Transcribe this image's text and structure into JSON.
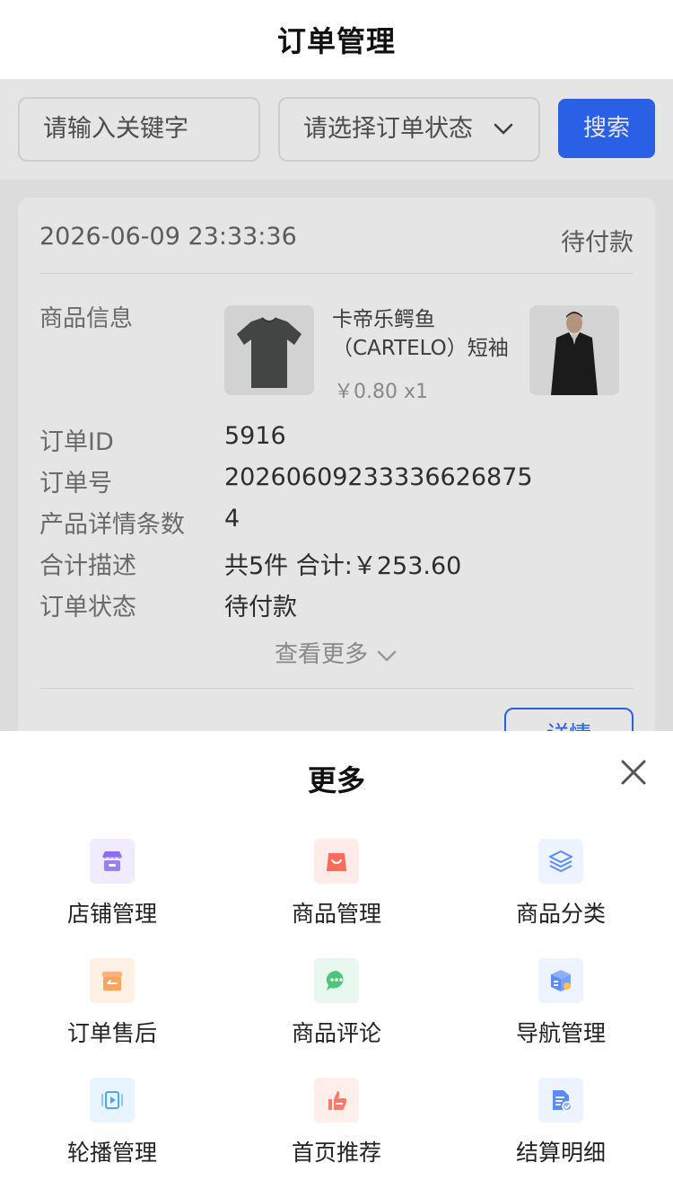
{
  "header": {
    "title": "订单管理"
  },
  "search": {
    "keyword_placeholder": "请输入关键字",
    "status_placeholder": "请选择订单状态",
    "search_label": "搜索"
  },
  "order": {
    "datetime": "2026-06-09 23:33:36",
    "status": "待付款",
    "product_info_label": "商品信息",
    "product_name": "卡帝乐鳄鱼（CARTELO）短袖T恤…",
    "product_price": "￥0.80 x1",
    "fields": [
      {
        "label": "订单ID",
        "value": "5916"
      },
      {
        "label": "订单号",
        "value": "20260609233336626875"
      },
      {
        "label": "产品详情条数",
        "value": "4"
      },
      {
        "label": "合计描述",
        "value": "共5件 合计:￥253.60"
      },
      {
        "label": "订单状态",
        "value": "待付款"
      }
    ],
    "see_more": "查看更多",
    "detail_button": "详情"
  },
  "more_sheet": {
    "title": "更多",
    "items": [
      {
        "label": "店铺管理",
        "icon": "store-icon",
        "color": "#8b6cf5"
      },
      {
        "label": "商品管理",
        "icon": "shopping-bag-icon",
        "color": "#ff6b5a"
      },
      {
        "label": "商品分类",
        "icon": "layers-icon",
        "color": "#5b8cff"
      },
      {
        "label": "订单售后",
        "icon": "box-return-icon",
        "color": "#ffa45c"
      },
      {
        "label": "商品评论",
        "icon": "chat-bubble-icon",
        "color": "#4cc67a"
      },
      {
        "label": "导航管理",
        "icon": "cube-icon",
        "color": "#5b8cff"
      },
      {
        "label": "轮播管理",
        "icon": "play-carousel-icon",
        "color": "#4aa8ff"
      },
      {
        "label": "首页推荐",
        "icon": "thumbs-up-icon",
        "color": "#ff7a6a"
      },
      {
        "label": "结算明细",
        "icon": "document-check-icon",
        "color": "#5b8cff"
      }
    ]
  }
}
